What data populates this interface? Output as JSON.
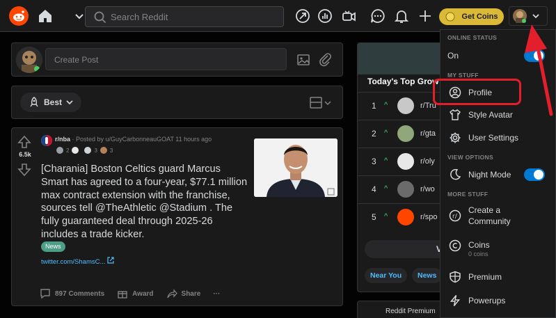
{
  "header": {
    "search_placeholder": "Search Reddit",
    "get_coins": "Get Coins"
  },
  "create_post": {
    "placeholder": "Create Post"
  },
  "sort": {
    "label": "Best"
  },
  "post": {
    "votes": "6.5k",
    "subreddit": "r/nba",
    "posted_by": "· Posted by u/GuyCarbonneauGOAT 11 hours ago",
    "awards": [
      {
        "count": "2",
        "color": "#9aa0a6"
      },
      {
        "count": "",
        "color": "#e8e8e8"
      },
      {
        "count": "3",
        "color": "#cfd3d6"
      },
      {
        "count": "3",
        "color": "#b5835a"
      }
    ],
    "title": "[Charania] Boston Celtics guard Marcus Smart has agreed to a four-year, $77.1 million max contract extension with the franchise, sources tell @TheAthletic @Stadium . The fully guaranteed deal through 2025-26 includes a trade kicker.",
    "flair": "News",
    "link": "twitter.com/ShamsC...",
    "comments": "897 Comments",
    "award": "Award",
    "share": "Share",
    "more": "···"
  },
  "trending": {
    "title": "Today's Top Grow",
    "rows": [
      {
        "rank": "1",
        "name": "r/Tru",
        "color": "#c8c8c8"
      },
      {
        "rank": "2",
        "name": "r/gta",
        "color": "#8fa77a"
      },
      {
        "rank": "3",
        "name": "r/oly",
        "color": "#e8e8e8"
      },
      {
        "rank": "4",
        "name": "r/wo",
        "color": "#6b6b6b"
      },
      {
        "rank": "5",
        "name": "r/spo",
        "color": "#ff4500"
      }
    ],
    "view_label": "Vi",
    "chips": [
      "Near You",
      "News"
    ]
  },
  "premium_card": {
    "label": "Reddit Premium"
  },
  "menu": {
    "online_status": {
      "heading": "ONLINE STATUS",
      "label": "On"
    },
    "my_stuff": {
      "heading": "MY STUFF",
      "items": [
        "Profile",
        "Style Avatar",
        "User Settings"
      ]
    },
    "view_options": {
      "heading": "VIEW OPTIONS",
      "night_mode": "Night Mode"
    },
    "more_stuff": {
      "heading": "MORE STUFF",
      "community_line1": "Create a",
      "community_line2": "Community",
      "coins": "Coins",
      "coins_sub": "0 coins",
      "premium": "Premium",
      "powerups": "Powerups"
    }
  },
  "colors": {
    "accent": "#0079d3",
    "brand": "#ff4500",
    "coins": "#d9b936",
    "highlight": "#e21f2a"
  }
}
